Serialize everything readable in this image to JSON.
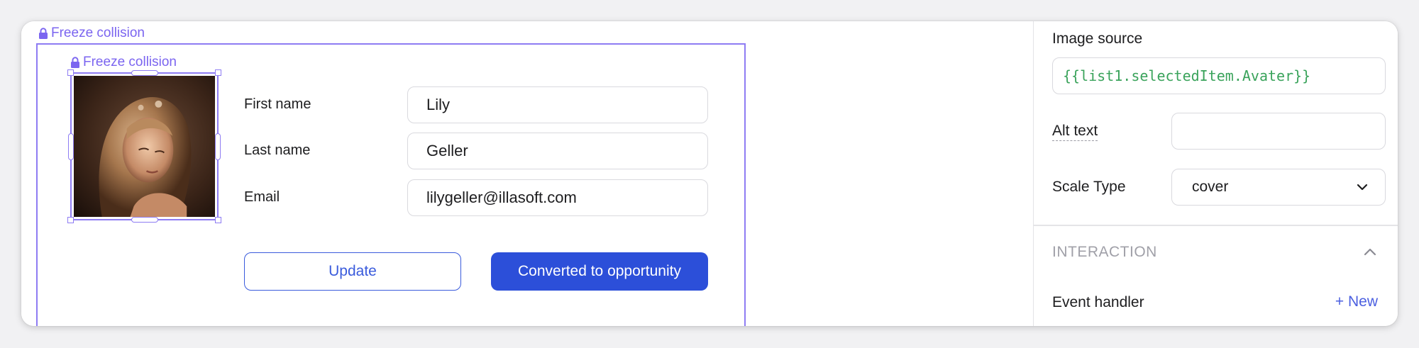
{
  "canvas": {
    "outer_freeze_label": "Freeze collision",
    "image_freeze_label": "Freeze collision",
    "form": {
      "first_name": {
        "label": "First name",
        "value": "Lily"
      },
      "last_name": {
        "label": "Last name",
        "value": "Geller"
      },
      "email": {
        "label": "Email",
        "value": "lilygeller@illasoft.com"
      }
    },
    "buttons": {
      "update": "Update",
      "convert": "Converted to opportunity"
    }
  },
  "panel": {
    "image_source": {
      "label": "Image source",
      "value": "{{list1.selectedItem.Avater}}"
    },
    "alt_text": {
      "label": "Alt text",
      "value": ""
    },
    "scale_type": {
      "label": "Scale Type",
      "value": "cover"
    },
    "interaction": {
      "section_title": "INTERACTION",
      "event_handler_label": "Event handler",
      "new_label": "+ New"
    }
  },
  "colors": {
    "accent": "#8e7cf3",
    "primary": "#2c4fd9",
    "code": "#3aa35b"
  }
}
